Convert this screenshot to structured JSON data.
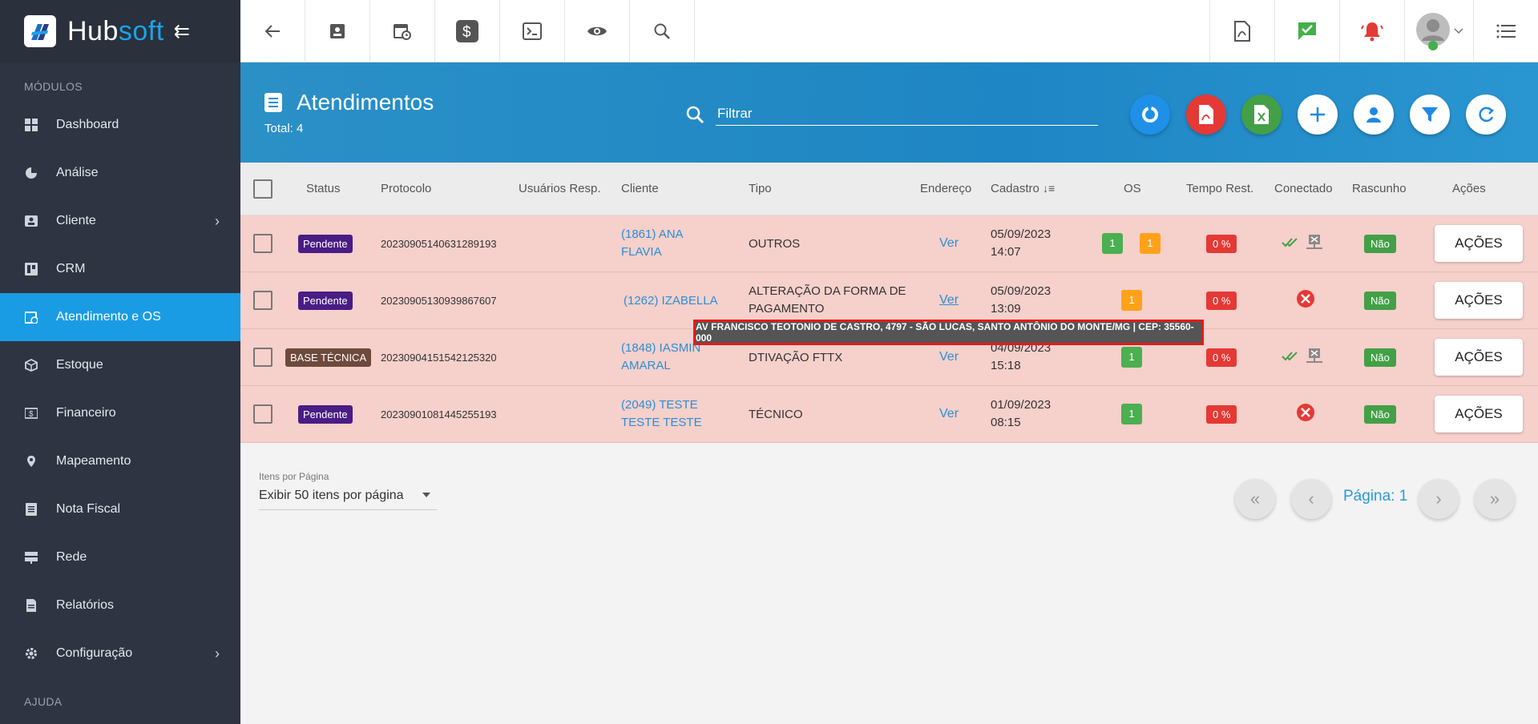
{
  "brand": {
    "name_a": "Hub",
    "name_b": "soft"
  },
  "sidebar": {
    "section_modules": "MÓDULOS",
    "items": [
      {
        "label": "Dashboard"
      },
      {
        "label": "Análise"
      },
      {
        "label": "Cliente"
      },
      {
        "label": "CRM"
      },
      {
        "label": "Atendimento e OS"
      },
      {
        "label": "Estoque"
      },
      {
        "label": "Financeiro"
      },
      {
        "label": "Mapeamento"
      },
      {
        "label": "Nota Fiscal"
      },
      {
        "label": "Rede"
      },
      {
        "label": "Relatórios"
      },
      {
        "label": "Configuração"
      }
    ],
    "section_help": "AJUDA"
  },
  "page": {
    "title": "Atendimentos",
    "total": "Total: 4",
    "filter_placeholder": "Filtrar"
  },
  "table": {
    "headers": {
      "status": "Status",
      "protocolo": "Protocolo",
      "usuarios": "Usuários Resp.",
      "cliente": "Cliente",
      "tipo": "Tipo",
      "endereco": "Endereço",
      "cadastro": "Cadastro",
      "os": "OS",
      "tempo": "Tempo Rest.",
      "conectado": "Conectado",
      "rascunho": "Rascunho",
      "acoes": "Ações"
    },
    "rows": [
      {
        "status": "Pendente",
        "protocolo": "20230905140631289193",
        "cliente": "(1861) ANA FLAVIA",
        "tipo": "OUTROS",
        "endereco": "Ver",
        "date": "05/09/2023",
        "time": "14:07",
        "os_a": "1",
        "os_b": "1",
        "tempo": "0 %",
        "rascunho": "Não",
        "acoes": "AÇÕES"
      },
      {
        "status": "Pendente",
        "protocolo": "20230905130939867607",
        "cliente": "(1262) IZABELLA",
        "tipo": "ALTERAÇÃO DA FORMA DE PAGAMENTO",
        "endereco": "Ver",
        "date": "05/09/2023",
        "time": "13:09",
        "os_a": "1",
        "tempo": "0 %",
        "rascunho": "Não",
        "acoes": "AÇÕES"
      },
      {
        "status": "BASE TÉCNICA",
        "protocolo": "20230904151542125320",
        "cliente": "(1848) IASMIN AMARAL",
        "tipo": "DTIVAÇÃO FTTX",
        "endereco": "Ver",
        "date": "04/09/2023",
        "time": "15:18",
        "os_a": "1",
        "tempo": "0 %",
        "rascunho": "Não",
        "acoes": "AÇÕES"
      },
      {
        "status": "Pendente",
        "protocolo": "20230901081445255193",
        "cliente": "(2049) TESTE TESTE TESTE",
        "tipo": "TÉCNICO",
        "endereco": "Ver",
        "date": "01/09/2023",
        "time": "08:15",
        "os_a": "1",
        "tempo": "0 %",
        "rascunho": "Não",
        "acoes": "AÇÕES"
      }
    ]
  },
  "tooltip": "AV FRANCISCO TEOTONIO DE CASTRO, 4797 - SÃO LUCAS, SANTO ANTÔNIO DO MONTE/MG | CEP: 35560-000",
  "pagination": {
    "per_page_label": "Itens por Página",
    "per_page_value": "Exibir 50 itens por página",
    "page_label": "Página: 1"
  }
}
